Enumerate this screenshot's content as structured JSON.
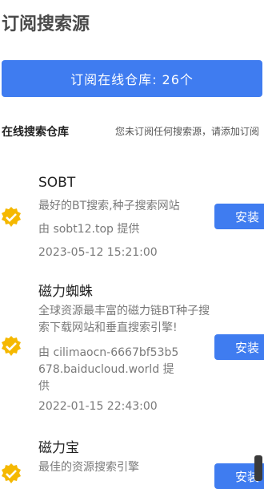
{
  "header": {
    "title": "订阅搜索源"
  },
  "subscribe": {
    "label": "订阅在线仓库: 26个"
  },
  "section": {
    "title": "在线搜索仓库",
    "note": "您未订阅任何搜索源，请添加订阅"
  },
  "sources": [
    {
      "name": "SOBT",
      "description": "最好的BT搜索,种子搜索网站",
      "provider": "由 sobt12.top 提供",
      "date": "2023-05-12 15:21:00",
      "install_label": "安装"
    },
    {
      "name": "磁力蜘蛛",
      "description": "全球资源最丰富的磁力链BT种子搜索下载网站和垂直搜索引擎!",
      "provider": "由 cilimaocn-6667bf53b5678.baiducloud.world 提供",
      "date": "2022-01-15 22:43:00",
      "install_label": "安装"
    },
    {
      "name": "磁力宝",
      "description": "最佳的资源搜索引擎",
      "install_label": "安装"
    }
  ],
  "colors": {
    "accent": "#3f7cf0",
    "check": "#f5b800"
  }
}
